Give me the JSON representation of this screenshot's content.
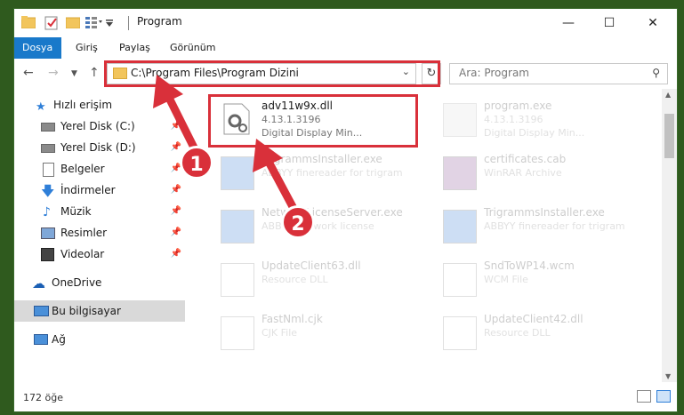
{
  "window": {
    "title": "Program",
    "controls": [
      "minimize",
      "maximize",
      "close"
    ]
  },
  "ribbon": {
    "tabs": [
      {
        "label": "Dosya",
        "active": true
      },
      {
        "label": "Giriş"
      },
      {
        "label": "Paylaş"
      },
      {
        "label": "Görünüm"
      }
    ]
  },
  "nav": {
    "address": "C:\\Program Files\\Program Dizini",
    "search_placeholder": "Ara: Program"
  },
  "sidebar": {
    "items": [
      {
        "label": "Hızlı erişim",
        "icon": "star-icon"
      },
      {
        "label": "Yerel Disk (C:)",
        "icon": "drive-icon",
        "pinned": true
      },
      {
        "label": "Yerel Disk (D:)",
        "icon": "drive-icon",
        "pinned": true
      },
      {
        "label": "Belgeler",
        "icon": "documents-icon",
        "pinned": true
      },
      {
        "label": "İndirmeler",
        "icon": "download-icon",
        "pinned": true
      },
      {
        "label": "Müzik",
        "icon": "music-icon",
        "pinned": true
      },
      {
        "label": "Resimler",
        "icon": "pictures-icon",
        "pinned": true
      },
      {
        "label": "Videolar",
        "icon": "video-icon",
        "pinned": true
      },
      {
        "label": "OneDrive",
        "icon": "cloud-icon"
      },
      {
        "label": "Bu bilgisayar",
        "icon": "computer-icon",
        "selected": true
      },
      {
        "label": "Ağ",
        "icon": "network-icon"
      }
    ]
  },
  "files": [
    {
      "name": "adv11w9x.dll",
      "meta1": "4.13.1.3196",
      "meta2": "Digital Display Min...",
      "icon": "dll-gear-icon",
      "highlighted": true
    },
    {
      "name": "program.exe",
      "meta1": "4.13.1.3196",
      "meta2": "Digital Display Min...",
      "icon": "exe-icon"
    },
    {
      "name": "TrigrammsInstaller.exe",
      "meta1": "ABBYY finereader for trigram",
      "icon": "installer-icon"
    },
    {
      "name": "certificates.cab",
      "meta1": "WinRAR Archive",
      "icon": "winrar-icon"
    },
    {
      "name": "NetworkLicenseServer.exe",
      "meta1": "ABBYY Network license",
      "icon": "installer-icon"
    },
    {
      "name": "TrigrammsInstaller.exe",
      "meta1": "ABBYY finereader for trigram",
      "icon": "installer-icon"
    },
    {
      "name": "UpdateClient63.dll",
      "meta1": "Resource DLL",
      "icon": "dll-icon"
    },
    {
      "name": "SndToWP14.wcm",
      "meta1": "WCM File",
      "icon": "file-icon"
    },
    {
      "name": "FastNml.cjk",
      "meta1": "CJK File",
      "icon": "file-icon"
    },
    {
      "name": "UpdateClient42.dll",
      "meta1": "Resource DLL",
      "icon": "dll-icon"
    }
  ],
  "status": {
    "count": "172 öğe"
  },
  "annotations": {
    "step1": "1",
    "step2": "2",
    "highlight_color": "#d9303a"
  }
}
